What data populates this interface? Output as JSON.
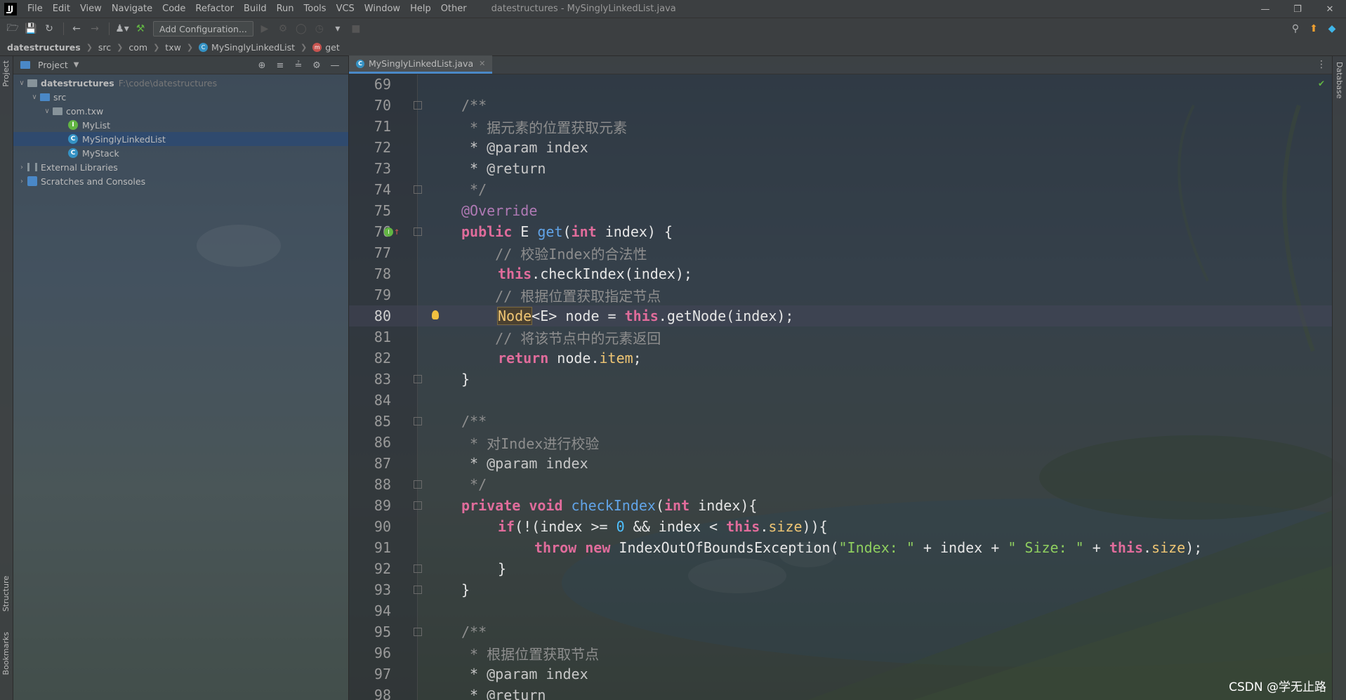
{
  "app": {
    "logo_text": "IJ",
    "window_title": "datestructures - MySinglyLinkedList.java"
  },
  "menu": [
    "File",
    "Edit",
    "View",
    "Navigate",
    "Code",
    "Refactor",
    "Build",
    "Run",
    "Tools",
    "VCS",
    "Window",
    "Help",
    "Other"
  ],
  "toolbar": {
    "config_label": "Add Configuration..."
  },
  "breadcrumb": {
    "items": [
      "datestructures",
      "src",
      "com",
      "txw",
      "MySinglyLinkedList",
      "get"
    ]
  },
  "left_strip": {
    "project_label": "Project",
    "structure_label": "Structure",
    "bookmarks_label": "Bookmarks"
  },
  "right_strip": {
    "database_label": "Database"
  },
  "project_panel": {
    "title": "Project",
    "tree": [
      {
        "label": "datestructures",
        "hint": "F:\\code\\datestructures"
      },
      {
        "label": "src"
      },
      {
        "label": "com.txw"
      },
      {
        "label": "MyList"
      },
      {
        "label": "MySinglyLinkedList"
      },
      {
        "label": "MyStack"
      },
      {
        "label": "External Libraries"
      },
      {
        "label": "Scratches and Consoles"
      }
    ]
  },
  "editor": {
    "tab_label": "MySinglyLinkedList.java",
    "current_line": 80,
    "lines": [
      {
        "n": "69"
      },
      {
        "n": "70"
      },
      {
        "n": "71"
      },
      {
        "n": "72"
      },
      {
        "n": "73"
      },
      {
        "n": "74"
      },
      {
        "n": "75"
      },
      {
        "n": "76"
      },
      {
        "n": "77"
      },
      {
        "n": "78"
      },
      {
        "n": "79"
      },
      {
        "n": "80"
      },
      {
        "n": "81"
      },
      {
        "n": "82"
      },
      {
        "n": "83"
      },
      {
        "n": "84"
      },
      {
        "n": "85"
      },
      {
        "n": "86"
      },
      {
        "n": "87"
      },
      {
        "n": "88"
      },
      {
        "n": "89"
      },
      {
        "n": "90"
      },
      {
        "n": "91"
      },
      {
        "n": "92"
      },
      {
        "n": "93"
      },
      {
        "n": "94"
      },
      {
        "n": "95"
      },
      {
        "n": "96"
      },
      {
        "n": "97"
      },
      {
        "n": "98"
      }
    ],
    "code": {
      "l70": "/**",
      "l71": " * 据元素的位置获取元素",
      "l72": " * @param index",
      "l73": " * @return",
      "l74": " */",
      "l75": "@Override",
      "l76_kw": "public",
      "l76_type": " E ",
      "l76_fn": "get",
      "l76_open": "(",
      "l76_int": "int",
      "l76_rest": " index) {",
      "l77": "    // 校验Index的合法性",
      "l78_this": "this",
      "l78_rest": ".checkIndex(index);",
      "l79": "    // 根据位置获取指定节点",
      "l80_node": "Node",
      "l80_mid": "<E> node = ",
      "l80_this": "this",
      "l80_rest": ".getNode(index);",
      "l81": "    // 将该节点中的元素返回",
      "l82_return": "return",
      "l82_mid": " node.",
      "l82_field": "item",
      "l82_end": ";",
      "l83": "}",
      "l85": "/**",
      "l86": " * 对Index进行校验",
      "l87": " * @param index",
      "l88": " */",
      "l89_private": "private",
      "l89_void": " void ",
      "l89_fn": "checkIndex",
      "l89_open": "(",
      "l89_int": "int",
      "l89_rest": " index){",
      "l90_if": "if",
      "l90_a": "(!(index >= ",
      "l90_zero": "0",
      "l90_b": " && index < ",
      "l90_this": "this",
      "l90_c": ".",
      "l90_size": "size",
      "l90_d": ")){",
      "l91_throw": "throw",
      "l91_sp": " ",
      "l91_new": "new",
      "l91_a": " IndexOutOfBoundsException(",
      "l91_s1": "\"Index: \"",
      "l91_b": " + index + ",
      "l91_s2": "\" Size: \"",
      "l91_c": " + ",
      "l91_this": "this",
      "l91_d": ".",
      "l91_size": "size",
      "l91_e": ");",
      "l92": "}",
      "l93": "}",
      "l95": "/**",
      "l96": " * 根据位置获取节点",
      "l97": " * @param index",
      "l98": " * @return"
    }
  },
  "watermark": "CSDN @学无止路",
  "colors": {
    "keyword": "#e06c9b",
    "comment": "#8e8e8e",
    "annotation": "#b07ab5",
    "function": "#61a4e8",
    "field": "#f0c674",
    "string": "#8fcf5f",
    "number": "#4fc1ff",
    "selection": "#2f4a6e"
  }
}
